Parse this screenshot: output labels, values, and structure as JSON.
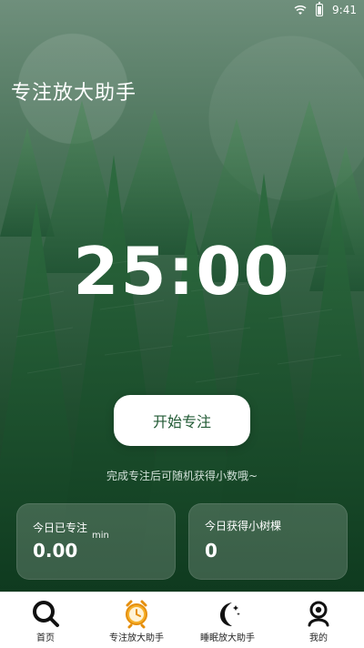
{
  "status": {
    "time": "9:41"
  },
  "app": {
    "title": "专注放大助手"
  },
  "timer": {
    "display": "25:00"
  },
  "start_button": {
    "label": "开始专注"
  },
  "hint": {
    "text": "完成专注后可随机获得小数哦~"
  },
  "stats": {
    "today_focus": {
      "label": "今日已专注",
      "value": "0.00",
      "unit": "min"
    },
    "today_trees": {
      "label": "今日获得小树棵",
      "value": "0"
    }
  },
  "tabs": [
    {
      "label": "首页",
      "icon": "search-icon"
    },
    {
      "label": "专注放大助手",
      "icon": "alarm-clock-icon"
    },
    {
      "label": "睡眠放大助手",
      "icon": "moon-stars-icon"
    },
    {
      "label": "我的",
      "icon": "user-icon"
    }
  ],
  "colors": {
    "accent_green": "#215a34",
    "tab_active": "#f0a21a"
  }
}
